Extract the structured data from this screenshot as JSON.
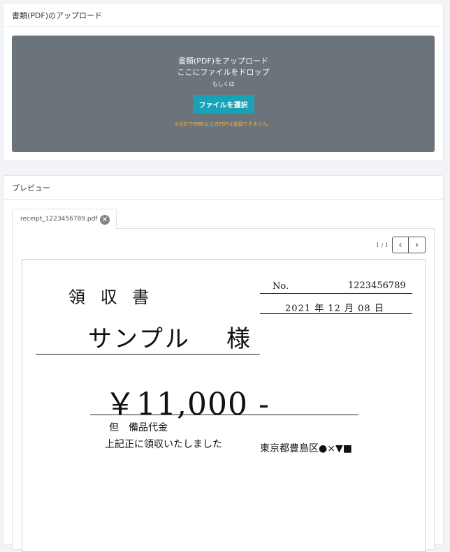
{
  "upload": {
    "header": "書類(PDF)のアップロード",
    "dropzone_title": "書類(PDF)をアップロード",
    "dropzone_drop": "ここにファイルをドロップ",
    "dropzone_or": "もしくは",
    "select_button": "ファイルを選択",
    "note": "※合計で8MB以上のPDFは登録できません。"
  },
  "preview": {
    "header": "プレビュー",
    "tab_filename": "receipt_1223456789.pdf",
    "tab_close_icon": "close-circle-icon",
    "page_indicator": "1 / 1",
    "prev_icon": "chevron-left-icon",
    "next_icon": "chevron-right-icon"
  },
  "receipt": {
    "title": "領 収 書",
    "no_label": "No.",
    "no_value": "1223456789",
    "date": "2021 年 12 月 08 日",
    "customer": "サンプル",
    "honorific": "様",
    "amount": "￥11,000 -",
    "note": "但　備品代金",
    "received": "上記正に領収いたしました",
    "address": "東京都豊島区●×▼■"
  },
  "colors": {
    "dropzone_bg": "#6b737b",
    "accent_button": "#17a2b8",
    "warning_text": "#f0b13d",
    "page_bg": "#f3f4f8"
  }
}
